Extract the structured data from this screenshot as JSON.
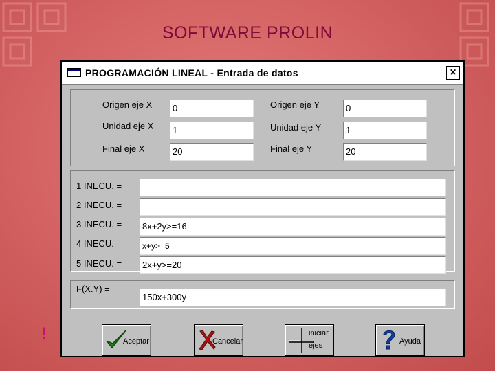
{
  "slide": {
    "title": "SOFTWARE PROLIN",
    "marker": "!"
  },
  "window": {
    "title": "PROGRAMACIÓN LINEAL - Entrada de datos",
    "close_label": "×"
  },
  "axes": {
    "origin_x_label": "Origen eje X",
    "origin_x_value": "0",
    "origin_y_label": "Origen eje Y",
    "origin_y_value": "0",
    "unit_x_label": "Unidad eje X",
    "unit_x_value": "1",
    "unit_y_label": "Unidad eje Y",
    "unit_y_value": "1",
    "end_x_label": "Final eje  X",
    "end_x_value": "20",
    "end_y_label": "Final eje Y",
    "end_y_value": "20"
  },
  "inequalities": [
    {
      "label": "1 INECU. =",
      "value": ""
    },
    {
      "label": "2 INECU. =",
      "value": ""
    },
    {
      "label": "3 INECU. =",
      "value": "8x+2y>=16"
    },
    {
      "label": "4 INECU. =",
      "value": "x+y>=5"
    },
    {
      "label": "5 INECU. =",
      "value": "2x+y>=20"
    }
  ],
  "objective": {
    "label": "F(X.Y) =",
    "value": "150x+300y"
  },
  "buttons": {
    "accept": "Aceptar",
    "cancel": "Cancelar",
    "init_axes_line1": "iniciar",
    "init_axes_line2": "ejes",
    "help": "Ayuda"
  },
  "colors": {
    "title": "#7a0b3a",
    "accept_check": "#1a8c1a",
    "cancel_x": "#b01010",
    "help_q": "#1040a0"
  }
}
